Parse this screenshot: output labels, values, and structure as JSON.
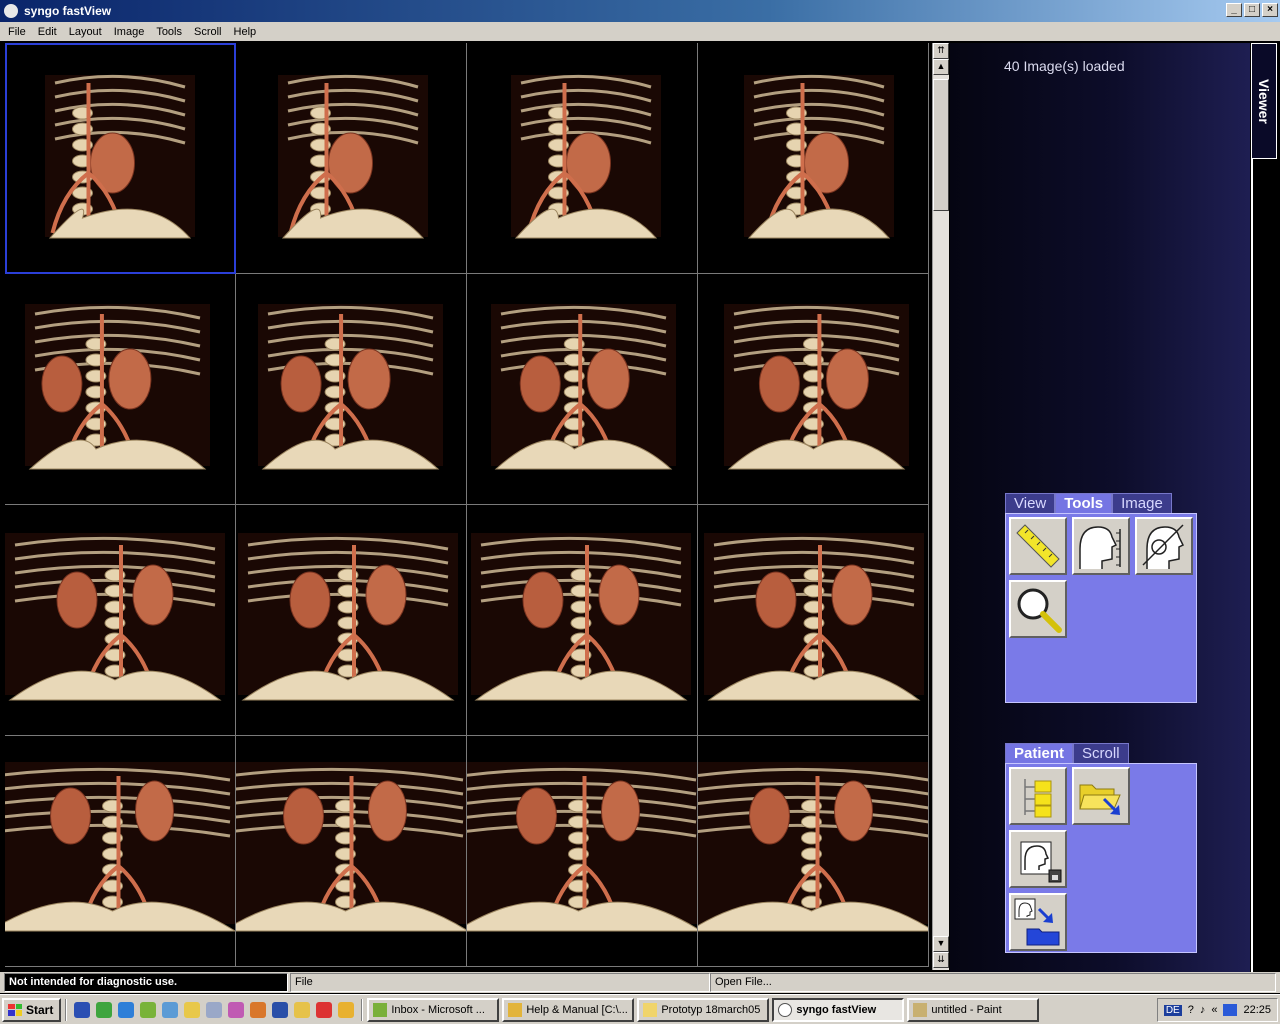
{
  "window": {
    "title": "syngo fastView"
  },
  "menu": [
    "File",
    "Edit",
    "Layout",
    "Image",
    "Tools",
    "Scroll",
    "Help"
  ],
  "viewer": {
    "loaded_text": "40 Image(s) loaded",
    "side_tab": "Viewer",
    "selected_index": 0,
    "image_count_visible": 16
  },
  "tool_tabs": {
    "view": "View",
    "tools": "Tools",
    "image": "Image",
    "active": "Tools"
  },
  "tool_icons": [
    "ruler-icon",
    "distance-measure-icon",
    "angle-measure-icon",
    "magnifier-icon"
  ],
  "patient_tabs": {
    "patient": "Patient",
    "scroll": "Scroll",
    "active": "Patient"
  },
  "patient_icons": [
    "patient-browser-icon",
    "open-folder-icon",
    "patient-save-icon",
    "export-to-folder-icon"
  ],
  "status": {
    "warning": "Not intended for diagnostic use.",
    "menu_hint": "File",
    "action_hint": "Open File..."
  },
  "taskbar": {
    "start": "Start",
    "tasks": [
      {
        "label": "Inbox - Microsoft ...",
        "active": false
      },
      {
        "label": "Help & Manual [C:\\...",
        "active": false
      },
      {
        "label": "Prototyp 18march05",
        "active": false
      },
      {
        "label": "syngo fastView",
        "active": true
      },
      {
        "label": "untitled - Paint",
        "active": false
      }
    ],
    "lang": "DE",
    "clock": "22:25"
  }
}
